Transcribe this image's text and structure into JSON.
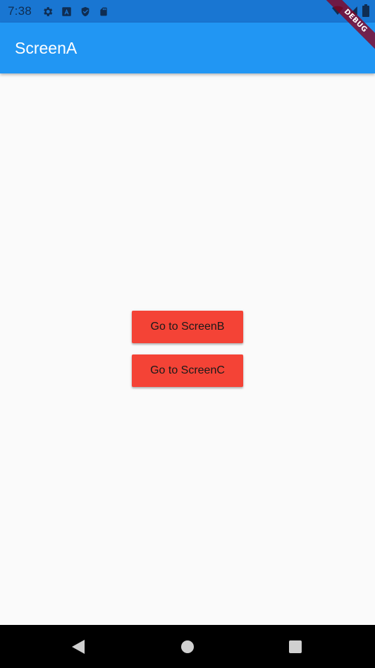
{
  "status_bar": {
    "time": "7:38",
    "left_icons": [
      "gear-icon",
      "a-square-icon",
      "shield-icon",
      "sd-card-icon"
    ],
    "right_icons": [
      "wifi-icon",
      "signal-icon",
      "battery-icon"
    ]
  },
  "app_bar": {
    "title": "ScreenA",
    "color": "#2196f3"
  },
  "main": {
    "buttons": [
      {
        "label": "Go to ScreenB",
        "color": "#f44336"
      },
      {
        "label": "Go to ScreenC",
        "color": "#f44336"
      }
    ]
  },
  "debug_banner": {
    "label": "DEBUG"
  },
  "nav_bar": {
    "buttons": [
      "back-icon",
      "home-icon",
      "recents-icon"
    ]
  }
}
